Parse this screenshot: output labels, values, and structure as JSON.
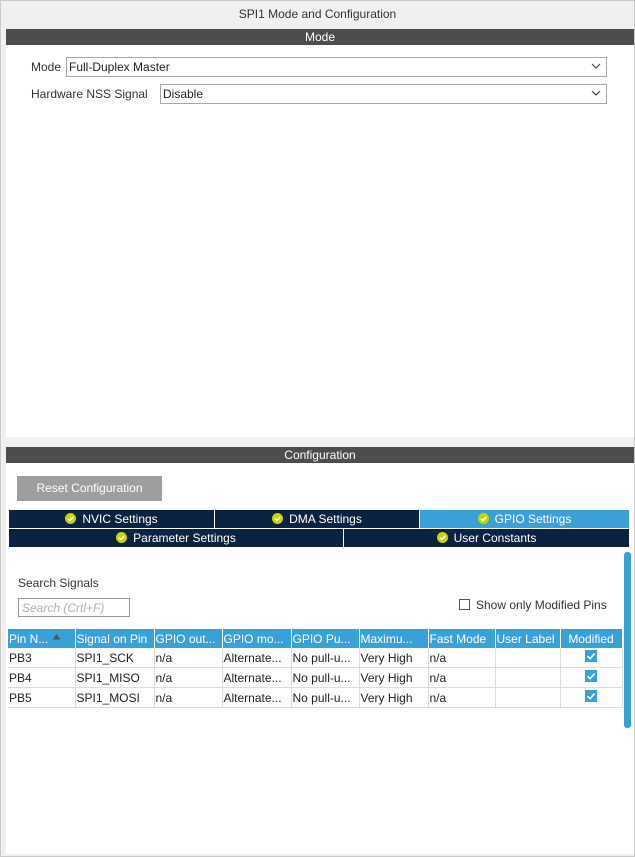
{
  "window": {
    "title": "SPI1 Mode and Configuration"
  },
  "mode_section": {
    "header": "Mode",
    "fields": [
      {
        "label": "Mode",
        "value": "Full-Duplex Master"
      },
      {
        "label": "Hardware NSS Signal",
        "value": "Disable"
      }
    ]
  },
  "config_section": {
    "header": "Configuration",
    "reset_button": "Reset Configuration",
    "tabs_row1": [
      {
        "label": "NVIC Settings",
        "active": false
      },
      {
        "label": "DMA Settings",
        "active": false
      },
      {
        "label": "GPIO Settings",
        "active": true
      }
    ],
    "tabs_row2": [
      {
        "label": "Parameter Settings",
        "active": false
      },
      {
        "label": "User Constants",
        "active": false
      }
    ],
    "search_label": "Search Signals",
    "search_placeholder": "Search (Crtl+F)",
    "show_modified_label": "Show only Modified Pins",
    "table": {
      "headers": [
        "Pin N...",
        "Signal on Pin",
        "GPIO out...",
        "GPIO mo...",
        "GPIO Pu...",
        "Maximu...",
        "Fast Mode",
        "User Label",
        "Modified"
      ],
      "rows": [
        [
          "PB3",
          "SPI1_SCK",
          "n/a",
          "Alternate...",
          "No pull-u...",
          "Very High",
          "n/a",
          "",
          true
        ],
        [
          "PB4",
          "SPI1_MISO",
          "n/a",
          "Alternate...",
          "No pull-u...",
          "Very High",
          "n/a",
          "",
          true
        ],
        [
          "PB5",
          "SPI1_MOSI",
          "n/a",
          "Alternate...",
          "No pull-u...",
          "Very High",
          "n/a",
          "",
          true
        ]
      ]
    }
  },
  "colors": {
    "band": "#4d4d4d",
    "tab_dark": "#0b2341",
    "accent": "#3aa0d8",
    "check_ok": "#c8d400"
  }
}
